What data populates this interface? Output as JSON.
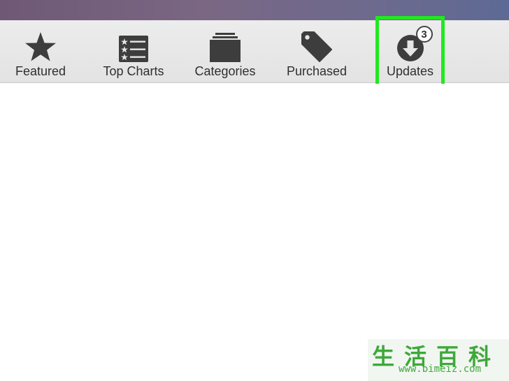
{
  "toolbar": {
    "tabs": [
      {
        "label": "Featured",
        "icon": "star-icon"
      },
      {
        "label": "Top Charts",
        "icon": "list-icon"
      },
      {
        "label": "Categories",
        "icon": "stack-icon"
      },
      {
        "label": "Purchased",
        "icon": "tag-icon"
      },
      {
        "label": "Updates",
        "icon": "download-icon",
        "badge": "3"
      }
    ],
    "highlight_color": "#22e81f",
    "text_color": "#2f2f2f"
  },
  "watermark": {
    "chars": "生活百科",
    "url": "www.bimeiz.com",
    "color": "#3ea83a"
  }
}
